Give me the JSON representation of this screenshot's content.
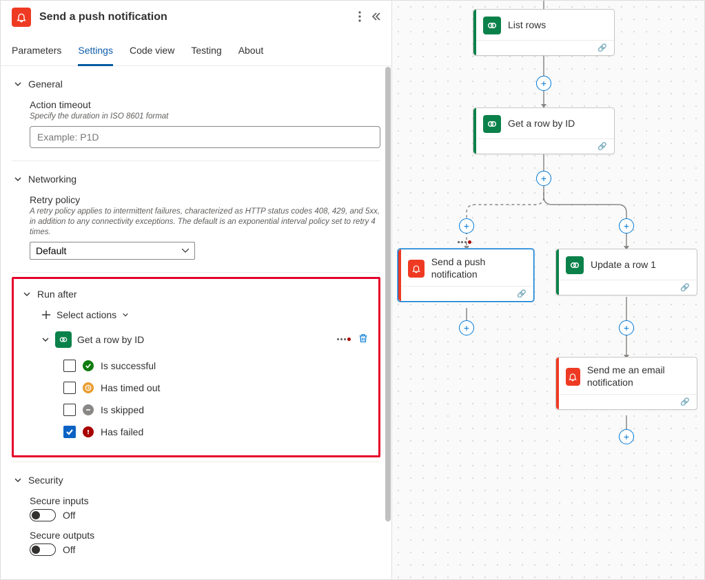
{
  "header": {
    "title": "Send a push notification"
  },
  "tabs": [
    "Parameters",
    "Settings",
    "Code view",
    "Testing",
    "About"
  ],
  "activeTab": "Settings",
  "sections": {
    "general": {
      "title": "General",
      "actionTimeout": {
        "label": "Action timeout",
        "desc": "Specify the duration in ISO 8601 format",
        "placeholder": "Example: P1D",
        "value": ""
      }
    },
    "networking": {
      "title": "Networking",
      "retryPolicy": {
        "label": "Retry policy",
        "desc": "A retry policy applies to intermittent failures, characterized as HTTP status codes 408, 429, and 5xx, in addition to any connectivity exceptions. The default is an exponential interval policy set to retry 4 times.",
        "value": "Default"
      }
    },
    "runAfter": {
      "title": "Run after",
      "selectActions": "Select actions",
      "source": "Get a row by ID",
      "statuses": [
        {
          "label": "Is successful",
          "icon": "success",
          "checked": false
        },
        {
          "label": "Has timed out",
          "icon": "timeout",
          "checked": false
        },
        {
          "label": "Is skipped",
          "icon": "skipped",
          "checked": false
        },
        {
          "label": "Has failed",
          "icon": "failed",
          "checked": true
        }
      ]
    },
    "security": {
      "title": "Security",
      "secureInputs": {
        "label": "Secure inputs",
        "state": "Off"
      },
      "secureOutputs": {
        "label": "Secure outputs",
        "state": "Off"
      }
    }
  },
  "flow": {
    "cards": {
      "listRows": {
        "label": "List rows"
      },
      "getRow": {
        "label": "Get a row by ID"
      },
      "push": {
        "label": "Send a push notification"
      },
      "updateRow": {
        "label": "Update a row 1"
      },
      "email": {
        "label": "Send me an email notification"
      }
    }
  }
}
